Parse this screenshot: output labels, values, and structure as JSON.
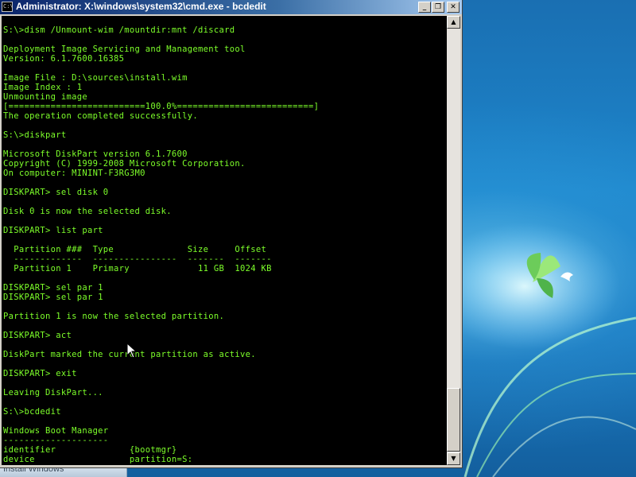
{
  "desktop": {
    "taskbar_item": "Install Windows"
  },
  "window": {
    "title": "Administrator: X:\\windows\\system32\\cmd.exe - bcdedit",
    "icon_text": "C:\\",
    "controls": {
      "minimize_glyph": "_",
      "restore_glyph": "❐",
      "close_glyph": "✕"
    }
  },
  "console": {
    "lines": [
      "",
      "S:\\>dism /Unmount-wim /mountdir:mnt /discard",
      "",
      "Deployment Image Servicing and Management tool",
      "Version: 6.1.7600.16385",
      "",
      "Image File : D:\\sources\\install.wim",
      "Image Index : 1",
      "Unmounting image",
      "[==========================100.0%==========================]",
      "The operation completed successfully.",
      "",
      "S:\\>diskpart",
      "",
      "Microsoft DiskPart version 6.1.7600",
      "Copyright (C) 1999-2008 Microsoft Corporation.",
      "On computer: MININT-F3RG3M0",
      "",
      "DISKPART> sel disk 0",
      "",
      "Disk 0 is now the selected disk.",
      "",
      "DISKPART> list part",
      "",
      "  Partition ###  Type              Size     Offset",
      "  -------------  ----------------  -------  -------",
      "  Partition 1    Primary             11 GB  1024 KB",
      "",
      "DISKPART> sel par 1",
      "DISKPART> sel par 1",
      "",
      "Partition 1 is now the selected partition.",
      "",
      "DISKPART> act",
      "",
      "DiskPart marked the current partition as active.",
      "",
      "DISKPART> exit",
      "",
      "Leaving DiskPart...",
      "",
      "S:\\>bcdedit",
      "",
      "Windows Boot Manager",
      "--------------------",
      "identifier              {bootmgr}",
      "device                  partition=S:"
    ]
  },
  "scrollbar": {
    "up_glyph": "▲",
    "down_glyph": "▼"
  }
}
